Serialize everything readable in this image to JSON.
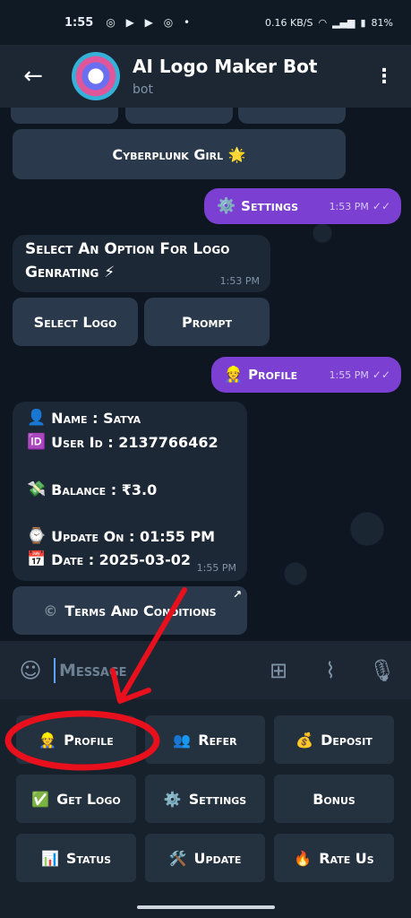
{
  "status_bar": {
    "time": "1:55",
    "notification_icons": "◎ ▶ ▶ ◎ •",
    "net_speed": "0.16 KB/S",
    "battery": "81%"
  },
  "header": {
    "title": "AI Logo Maker Bot",
    "subtitle": "bot"
  },
  "chat": {
    "top_button": "Cyberplunk Girl 🌟",
    "settings_msg": {
      "icon": "⚙️",
      "text": "Settings",
      "time": "1:53 PM"
    },
    "select_msg": {
      "line1": "Select An Option For Logo",
      "line2": "Genrating ⚡",
      "time": "1:53 PM"
    },
    "inline_buttons": [
      "Select Logo",
      "Prompt"
    ],
    "profile_msg": {
      "icon": "👷",
      "text": "Profile",
      "time": "1:55 PM"
    },
    "info": {
      "name": {
        "icon": "👤",
        "text": "Name : Satya"
      },
      "user_id": {
        "icon": "🆔",
        "text": "User Id : 2137766462"
      },
      "balance": {
        "icon": "💸",
        "text": "Balance : ₹3.0"
      },
      "update": {
        "icon": "⌚",
        "text": "Update On : 01:55 PM"
      },
      "date": {
        "icon": "📅",
        "text": "Date : 2025-03-02"
      },
      "time": "1:55 PM"
    },
    "terms_button": {
      "icon": "©",
      "text": "Terms And Conditions",
      "corner_icon": "↗"
    }
  },
  "input": {
    "placeholder": "Message"
  },
  "keyboard": {
    "rows": [
      [
        {
          "icon": "👷",
          "label": "Profile"
        },
        {
          "icon": "👥",
          "label": "Refer"
        },
        {
          "icon": "💰",
          "label": "Deposit"
        }
      ],
      [
        {
          "icon": "✅",
          "label": "Get Logo"
        },
        {
          "icon": "⚙️",
          "label": "Settings"
        },
        {
          "icon": "",
          "label": "Bonus"
        }
      ],
      [
        {
          "icon": "📊",
          "label": "Status"
        },
        {
          "icon": "🛠️",
          "label": "Update"
        },
        {
          "icon": "🔥",
          "label": "Rate Us"
        }
      ]
    ]
  },
  "colors": {
    "accent_bubble": "#7b3fd1",
    "annotation": "#e8101c"
  }
}
